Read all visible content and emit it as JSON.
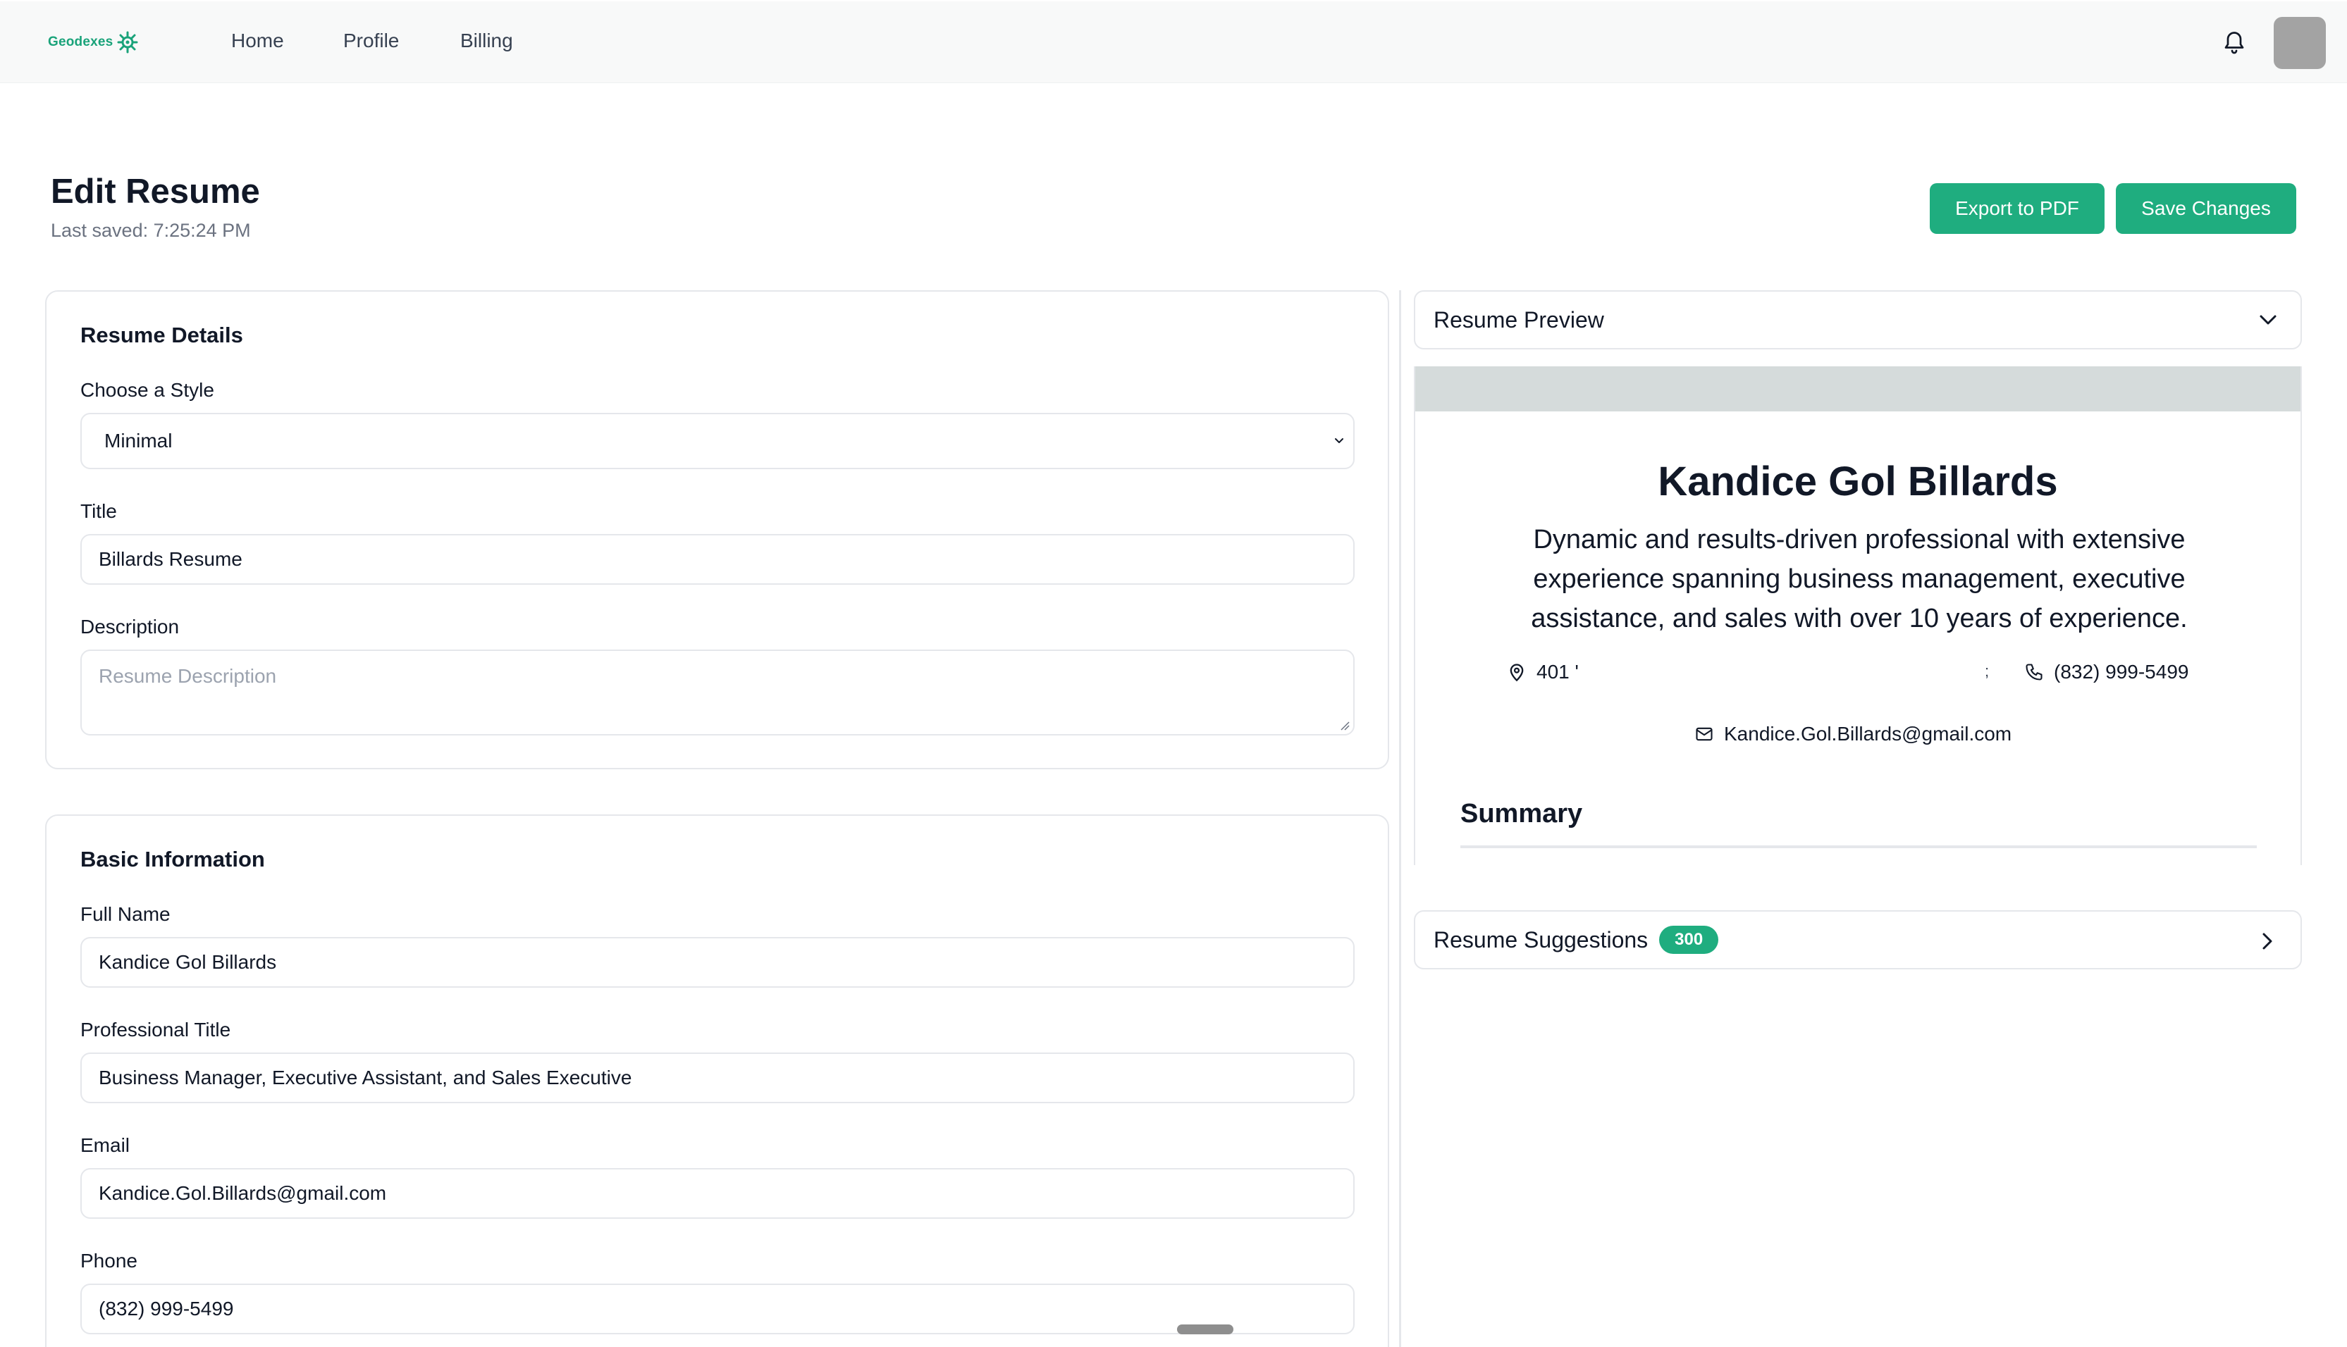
{
  "nav": {
    "brand": "Geodexes",
    "links": [
      "Home",
      "Profile",
      "Billing"
    ]
  },
  "header": {
    "title": "Edit Resume",
    "last_saved": "Last saved: 7:25:24 PM",
    "export_label": "Export to PDF",
    "save_label": "Save Changes"
  },
  "details": {
    "heading": "Resume Details",
    "style_label": "Choose a Style",
    "style_value": "Minimal",
    "title_label": "Title",
    "title_value": "Billards Resume",
    "description_label": "Description",
    "description_placeholder": "Resume Description"
  },
  "basic": {
    "heading": "Basic Information",
    "full_name_label": "Full Name",
    "full_name_value": "Kandice Gol Billards",
    "professional_title_label": "Professional Title",
    "professional_title_value": "Business Manager, Executive Assistant, and Sales Executive",
    "email_label": "Email",
    "email_value": "Kandice.Gol.Billards@gmail.com",
    "phone_label": "Phone",
    "phone_value": "(832) 999-5499"
  },
  "preview": {
    "header": "Resume Preview",
    "name": "Kandice Gol Billards",
    "headline": "Dynamic and results-driven professional with extensive experience spanning business management, executive assistance, and sales with over 10 years of experience.",
    "address": "401 '",
    "separator": ";",
    "phone": "(832) 999-5499",
    "email": "Kandice.Gol.Billards@gmail.com",
    "summary_heading": "Summary"
  },
  "suggestions": {
    "label": "Resume Suggestions",
    "count": "300"
  },
  "colors": {
    "accent": "#1fad7f",
    "brand": "#1aa37a",
    "avatar": "#a3a3a3",
    "preview_band": "#d5dbdb"
  },
  "icons": [
    "logo-mark-icon",
    "bell-icon",
    "chevron-down-icon",
    "map-pin-icon",
    "phone-icon",
    "mail-icon",
    "chevron-right-icon",
    "resize-grip-icon"
  ]
}
